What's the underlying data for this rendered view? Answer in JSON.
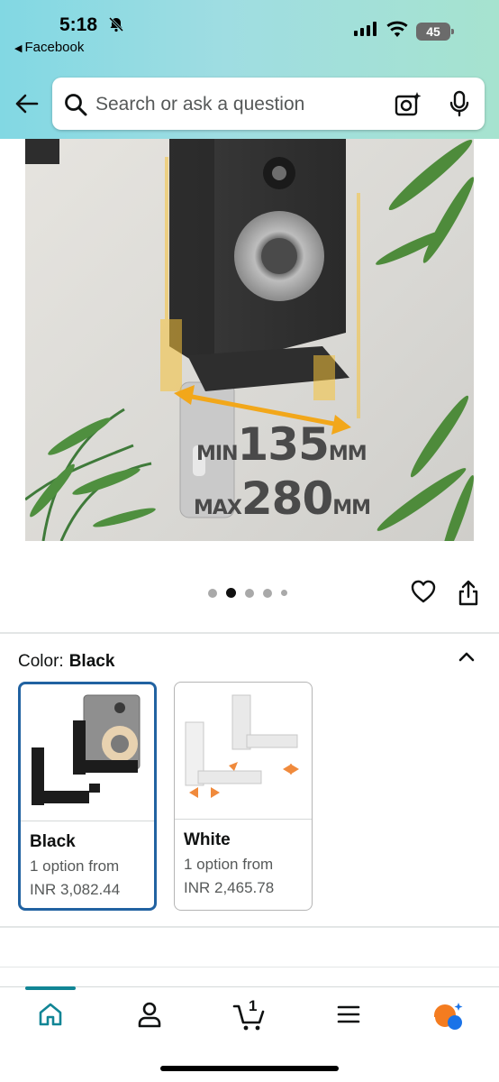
{
  "status_bar": {
    "time": "5:18",
    "back_app": "Facebook",
    "battery": "45"
  },
  "search": {
    "placeholder": "Search or ask a question"
  },
  "product_image": {
    "overlay_min_prefix": "MIN",
    "overlay_min_value": "135",
    "overlay_min_unit": "MM",
    "overlay_max_prefix": "MAX",
    "overlay_max_value": "280",
    "overlay_max_unit": "MM",
    "current_index": 2,
    "total_images": 5
  },
  "variation": {
    "label": "Color:",
    "selected": "Black",
    "options": [
      {
        "name": "Black",
        "availability": "1 option from",
        "price": "INR 3,082.44",
        "selected": true
      },
      {
        "name": "White",
        "availability": "1 option from",
        "price": "INR 2,465.78",
        "selected": false
      }
    ]
  },
  "bottom_nav": {
    "cart_count": "1",
    "items": [
      "home-icon",
      "account-icon",
      "cart-icon",
      "menu-icon",
      "rufus-icon"
    ]
  },
  "colors": {
    "header_gradient_start": "#82d8e3",
    "header_gradient_end": "#a6e3cf",
    "accent_teal": "#118595",
    "selected_border": "#2162a1"
  }
}
